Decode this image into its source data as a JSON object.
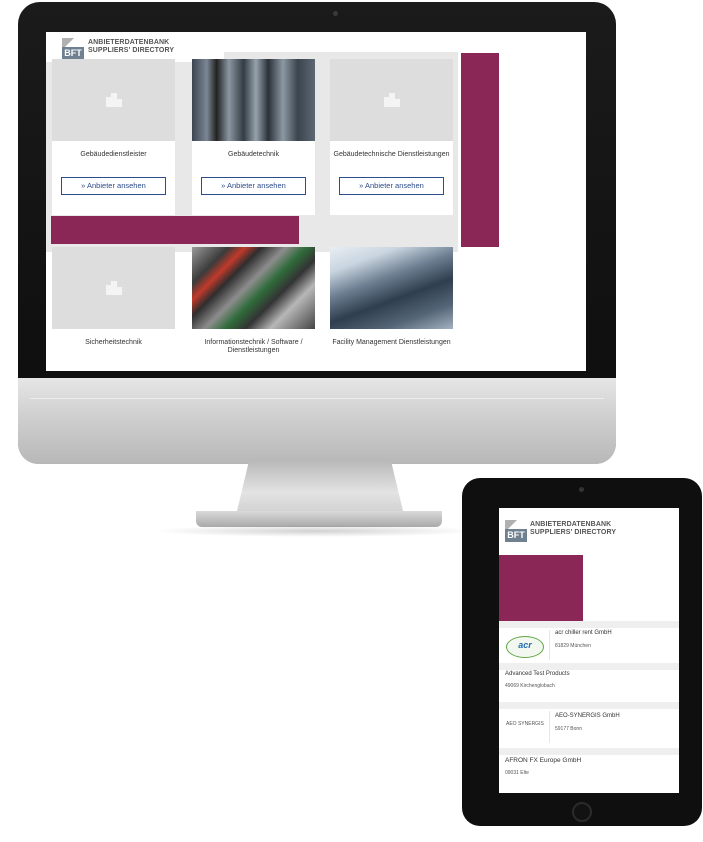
{
  "logo": {
    "mark": "BFT",
    "line1": "ANBIETERDATENBANK",
    "line2": "SUPPLIERS' DIRECTORY"
  },
  "desktop": {
    "cards": [
      {
        "label": "Gebäudedienstleister",
        "button": "» Anbieter ansehen",
        "image": "building-icon"
      },
      {
        "label": "Gebäudetechnik",
        "button": "» Anbieter ansehen",
        "image": "photo-gauges"
      },
      {
        "label": "Gebäudetechnische Dienstleistungen",
        "button": "» Anbieter ansehen",
        "image": "building-icon"
      },
      {
        "label": "Sicherheitstechnik",
        "button": "",
        "image": "building-icon"
      },
      {
        "label": "Informationstechnik / Software / Dienstleistungen",
        "button": "",
        "image": "photo-connectors"
      },
      {
        "label": "Facility Management Dienstleistungen",
        "button": "",
        "image": "photo-glass-building"
      }
    ],
    "accent_color": "#8b2757"
  },
  "tablet": {
    "entries": [
      {
        "name": "acr chiller rent GmbH",
        "city": "81829 München",
        "logo": "acr"
      },
      {
        "name": "Advanced Test Products",
        "city": "49069 Kirchenglobach"
      },
      {
        "name": "AEO-SYNERGIS GmbH",
        "city": "59177 Bonn",
        "logo": "AEO SYNERGIS"
      },
      {
        "name": "AFRON FX Europe GmbH",
        "city": "09031 Elte"
      }
    ]
  }
}
